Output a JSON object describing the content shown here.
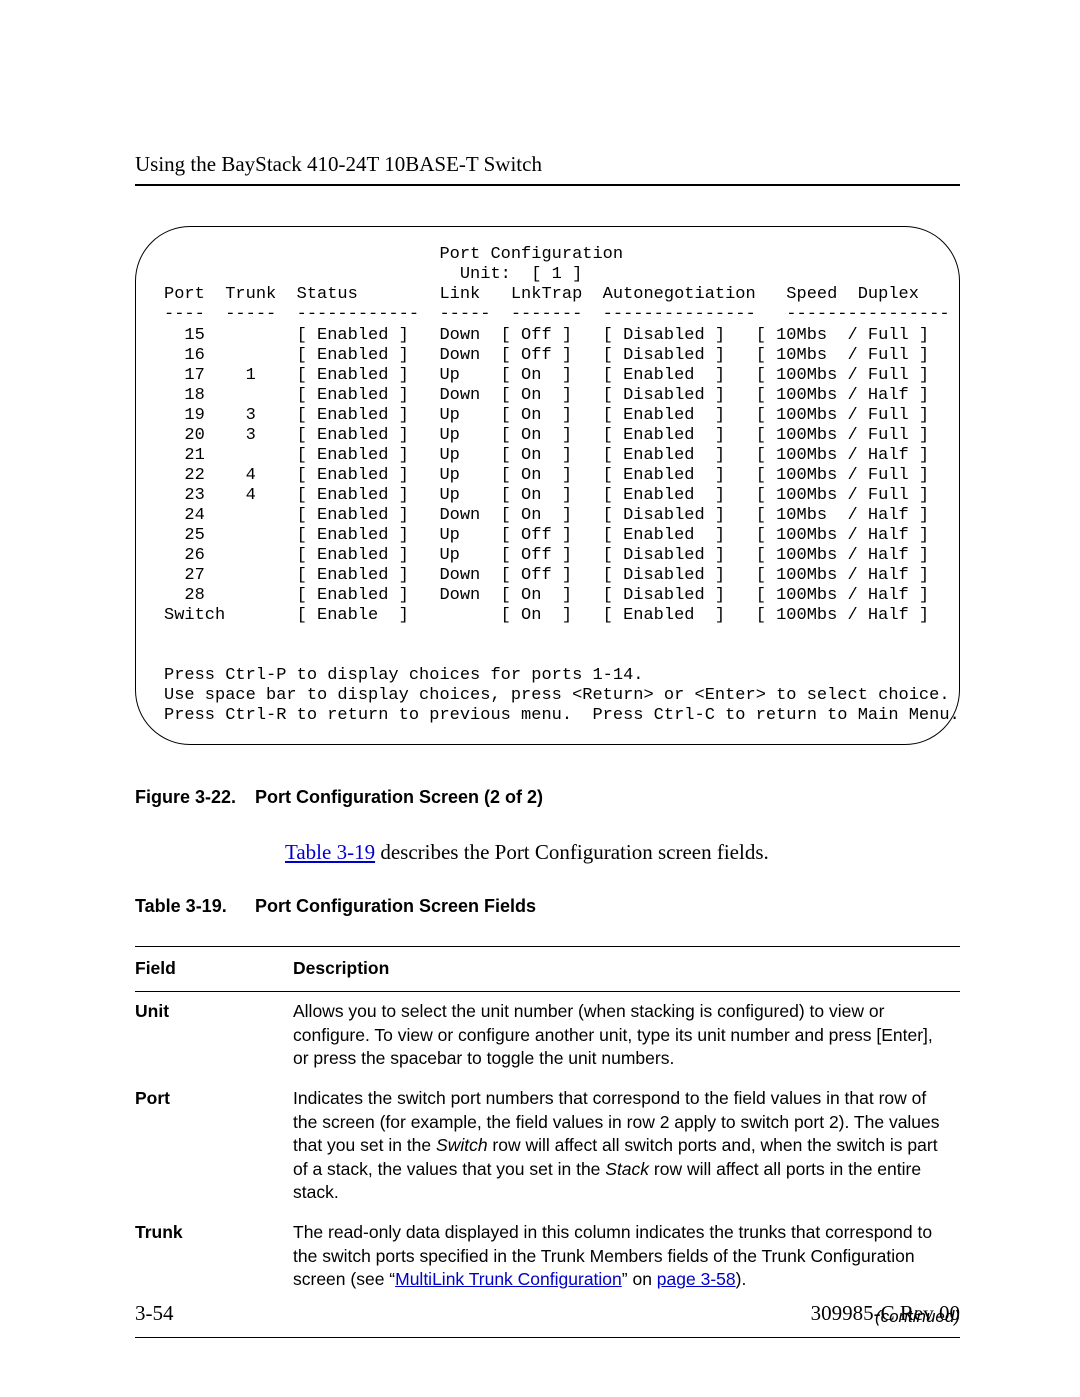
{
  "header": {
    "title": "Using the BayStack 410-24T 10BASE-T Switch"
  },
  "terminal": {
    "title": "Port Configuration",
    "unit_line": "Unit:  [ 1 ]",
    "cols": {
      "port": "Port",
      "trunk": "Trunk",
      "status": "Status",
      "link": "Link",
      "lnktrap": "LnkTrap",
      "autoneg": "Autonegotiation",
      "speed": "Speed",
      "duplex": "Duplex"
    },
    "rows": [
      {
        "port": "15",
        "trunk": "",
        "link": "Down",
        "lnktrap": "Off",
        "autoneg": "Disabled",
        "speed": "10Mbs",
        "duplex": "Full"
      },
      {
        "port": "16",
        "trunk": "",
        "link": "Down",
        "lnktrap": "Off",
        "autoneg": "Disabled",
        "speed": "10Mbs",
        "duplex": "Full"
      },
      {
        "port": "17",
        "trunk": "1",
        "link": "Up",
        "lnktrap": "On",
        "autoneg": "Enabled",
        "speed": "100Mbs",
        "duplex": "Full"
      },
      {
        "port": "18",
        "trunk": "",
        "link": "Down",
        "lnktrap": "On",
        "autoneg": "Disabled",
        "speed": "100Mbs",
        "duplex": "Half"
      },
      {
        "port": "19",
        "trunk": "3",
        "link": "Up",
        "lnktrap": "On",
        "autoneg": "Enabled",
        "speed": "100Mbs",
        "duplex": "Full"
      },
      {
        "port": "20",
        "trunk": "3",
        "link": "Up",
        "lnktrap": "On",
        "autoneg": "Enabled",
        "speed": "100Mbs",
        "duplex": "Full"
      },
      {
        "port": "21",
        "trunk": "",
        "link": "Up",
        "lnktrap": "On",
        "autoneg": "Enabled",
        "speed": "100Mbs",
        "duplex": "Half"
      },
      {
        "port": "22",
        "trunk": "4",
        "link": "Up",
        "lnktrap": "On",
        "autoneg": "Enabled",
        "speed": "100Mbs",
        "duplex": "Full"
      },
      {
        "port": "23",
        "trunk": "4",
        "link": "Up",
        "lnktrap": "On",
        "autoneg": "Enabled",
        "speed": "100Mbs",
        "duplex": "Full"
      },
      {
        "port": "24",
        "trunk": "",
        "link": "Down",
        "lnktrap": "On",
        "autoneg": "Disabled",
        "speed": "10Mbs",
        "duplex": "Half"
      },
      {
        "port": "25",
        "trunk": "",
        "link": "Up",
        "lnktrap": "Off",
        "autoneg": "Enabled",
        "speed": "100Mbs",
        "duplex": "Half"
      },
      {
        "port": "26",
        "trunk": "",
        "link": "Up",
        "lnktrap": "Off",
        "autoneg": "Disabled",
        "speed": "100Mbs",
        "duplex": "Half"
      },
      {
        "port": "27",
        "trunk": "",
        "link": "Down",
        "lnktrap": "Off",
        "autoneg": "Disabled",
        "speed": "100Mbs",
        "duplex": "Half"
      },
      {
        "port": "28",
        "trunk": "",
        "link": "Down",
        "lnktrap": "On",
        "autoneg": "Disabled",
        "speed": "100Mbs",
        "duplex": "Half"
      }
    ],
    "switch_row": {
      "port": "Switch",
      "status": "Enable",
      "lnktrap": "On",
      "autoneg": "Enabled",
      "speed": "100Mbs",
      "duplex": "Half"
    },
    "hint1": "Press Ctrl-P to display choices for ports 1-14.",
    "hint2": "Use space bar to display choices, press <Return> or <Enter> to select choice.",
    "hint3": "Press Ctrl-R to return to previous menu.  Press Ctrl-C to return to Main Menu."
  },
  "figure": {
    "label": "Figure 3-22.",
    "caption": "Port Configuration Screen (2 of 2)"
  },
  "para": {
    "link": "Table 3-19",
    "rest": " describes the Port Configuration screen fields."
  },
  "table_caption": {
    "label": "Table 3-19.",
    "caption": "Port Configuration Screen Fields"
  },
  "field_table": {
    "head_field": "Field",
    "head_desc": "Description",
    "rows": [
      {
        "field": "Unit",
        "desc_plain": "Allows you to select the unit number (when stacking is configured) to view or configure. To view or configure another unit, type its unit number and press [Enter], or press the spacebar to toggle the unit numbers."
      },
      {
        "field": "Port",
        "desc_pre": "Indicates the switch port numbers that correspond to the field values in that row of the screen (for example, the field values in row 2 apply to switch port 2). The values that you set in the ",
        "italic1": "Switch",
        "desc_mid": " row will affect all switch ports and, when the switch is part of a stack, the values that you set in the ",
        "italic2": "Stack",
        "desc_post": " row will affect all ports in the entire stack."
      },
      {
        "field": "Trunk",
        "desc_pre2": "The read-only data displayed in this column indicates the trunks that correspond to the switch ports specified in the Trunk Members fields of the Trunk Configuration screen (see “",
        "link1": "MultiLink Trunk Configuration",
        "desc_mid2": "” on ",
        "link2": "page 3-58",
        "desc_post2": ")."
      }
    ],
    "continued": "(continued)"
  },
  "footer": {
    "page": "3-54",
    "doc": "309985-C Rev 00"
  }
}
